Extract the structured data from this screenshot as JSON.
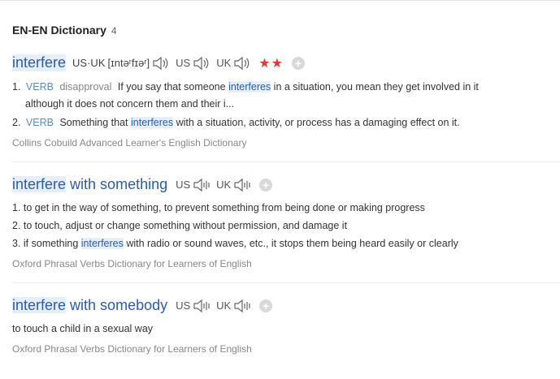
{
  "header": {
    "title": "EN-EN Dictionary",
    "count": "4"
  },
  "entry1": {
    "word": "interfere",
    "pron_label": "US·UK",
    "ipa": "[ɪntəʳfɪəʳ]",
    "us_label": "US",
    "uk_label": "UK",
    "stars": "★★",
    "add": "+",
    "defs": [
      {
        "num": "1.",
        "pos": "VERB",
        "register": "disapproval",
        "pre": "If you say that someone ",
        "hl": "interferes",
        "post": " in a situation, you mean they get involved in it",
        "cont": "although it does not concern them and their i..."
      },
      {
        "num": "2.",
        "pos": "VERB",
        "pre": "Something that ",
        "hl": "interferes",
        "post": " with a situation, activity, or process has a damaging effect on it."
      }
    ],
    "source": "Collins Cobuild Advanced Learner's English Dictionary"
  },
  "entry2": {
    "word_hl": "interfere",
    "word_rest": " with something",
    "us_label": "US",
    "uk_label": "UK",
    "add": "+",
    "defs": [
      {
        "text": "1. to get in the way of something, to prevent something from being done or making progress"
      },
      {
        "text": "2. to touch, adjust or change something without permission, and damage it"
      },
      {
        "pre": "3. if something ",
        "hl": "interferes",
        "post": " with radio or sound waves, etc., it stops them being heard easily or clearly"
      }
    ],
    "source": "Oxford Phrasal Verbs Dictionary for Learners of English"
  },
  "entry3": {
    "word_hl": "interfere",
    "word_rest": " with somebody",
    "us_label": "US",
    "uk_label": "UK",
    "add": "+",
    "def": "to touch a child in a sexual way",
    "source": "Oxford Phrasal Verbs Dictionary for Learners of English"
  },
  "icons": {
    "speaker": "speaker-icon",
    "add": "plus-icon",
    "star": "star-icon"
  },
  "colors": {
    "link": "#2a5db0",
    "highlight": "#e6eef9",
    "star": "#e03b2f",
    "pos": "#5a8ac6"
  }
}
